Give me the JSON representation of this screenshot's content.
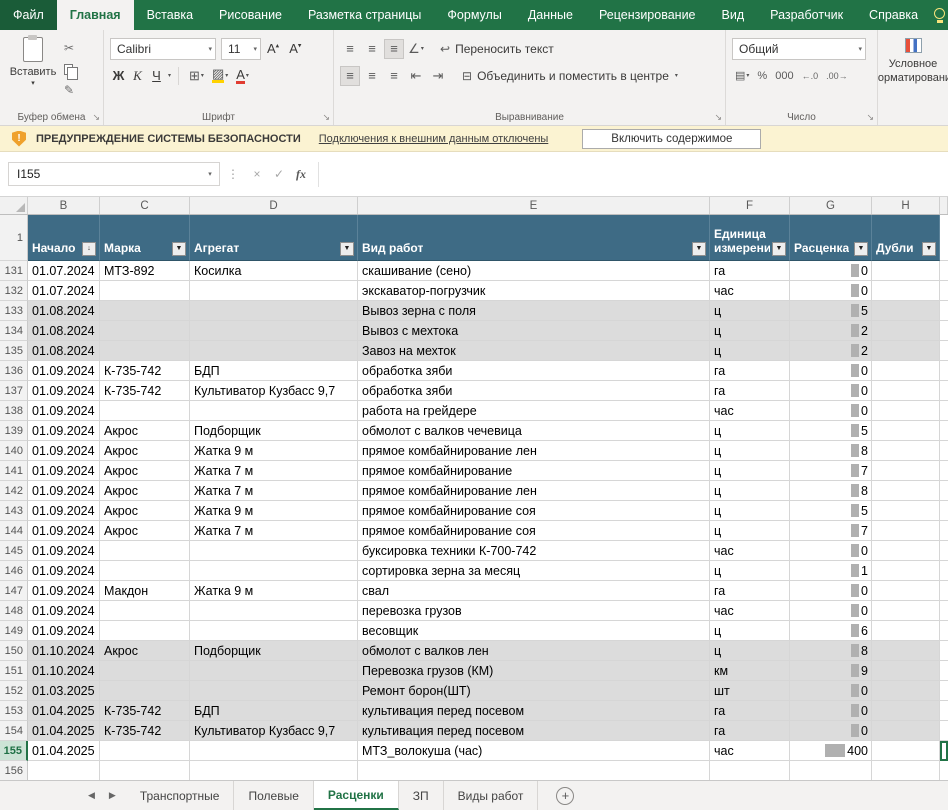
{
  "ribbon": {
    "tabs": [
      {
        "label": "Файл",
        "file": true
      },
      {
        "label": "Главная",
        "active": true
      },
      {
        "label": "Вставка"
      },
      {
        "label": "Рисование"
      },
      {
        "label": "Разметка страницы"
      },
      {
        "label": "Формулы"
      },
      {
        "label": "Данные"
      },
      {
        "label": "Рецензирование"
      },
      {
        "label": "Вид"
      },
      {
        "label": "Разработчик"
      },
      {
        "label": "Справка"
      }
    ],
    "clipboard": {
      "group_label": "Буфер обмена",
      "paste_label": "Вставить"
    },
    "font": {
      "group_label": "Шрифт",
      "font_name": "Calibri",
      "font_size": "11",
      "bold": "Ж",
      "italic": "К",
      "underline": "Ч"
    },
    "alignment": {
      "group_label": "Выравнивание",
      "wrap_text": "Переносить текст",
      "merge_center": "Объединить и поместить в центре"
    },
    "number": {
      "group_label": "Число",
      "format": "Общий",
      "percent_icon": "%",
      "thousands_icon": "000",
      "inc_decimal_icon": "←.0",
      "dec_decimal_icon": ".00→"
    },
    "conditional": {
      "line1": "Условное",
      "line2": "форматирование"
    }
  },
  "security": {
    "title": "ПРЕДУПРЕЖДЕНИЕ СИСТЕМЫ БЕЗОПАСНОСТИ",
    "message": "Подключения к внешним данным отключены",
    "button": "Включить содержимое"
  },
  "formula_bar": {
    "name_box": "I155",
    "formula": ""
  },
  "sheet": {
    "columns": [
      "B",
      "C",
      "D",
      "E",
      "F",
      "G",
      "H"
    ],
    "headers": [
      {
        "label": "Начало",
        "sorted": true
      },
      {
        "label": "Марка"
      },
      {
        "label": "Агрегат"
      },
      {
        "label": "Вид работ"
      },
      {
        "label": "Единица измерени"
      },
      {
        "label": "Расценка"
      },
      {
        "label": "Дубли"
      }
    ],
    "bar_max": 400,
    "rows": [
      {
        "n": 131,
        "b": "01.07.2024",
        "c": "МТЗ-892",
        "d": "Косилка",
        "e": "скашивание (сено)",
        "f": "га",
        "g": 0
      },
      {
        "n": 132,
        "b": "01.07.2024",
        "c": "",
        "d": "",
        "e": "экскаватор-погрузчик",
        "f": "час",
        "g": 0
      },
      {
        "n": 133,
        "b": "01.08.2024",
        "c": "",
        "d": "",
        "e": "Вывоз зерна с поля",
        "f": "ц",
        "g": 5,
        "shaded": true
      },
      {
        "n": 134,
        "b": "01.08.2024",
        "c": "",
        "d": "",
        "e": "Вывоз с мехтока",
        "f": "ц",
        "g": 2,
        "shaded": true
      },
      {
        "n": 135,
        "b": "01.08.2024",
        "c": "",
        "d": "",
        "e": "Завоз на мехток",
        "f": "ц",
        "g": 2,
        "shaded": true
      },
      {
        "n": 136,
        "b": "01.09.2024",
        "c": "К-735-742",
        "d": "БДП",
        "e": "обработка зяби",
        "f": "га",
        "g": 0
      },
      {
        "n": 137,
        "b": "01.09.2024",
        "c": "К-735-742",
        "d": "Культиватор Кузбасс 9,7",
        "e": "обработка зяби",
        "f": "га",
        "g": 0
      },
      {
        "n": 138,
        "b": "01.09.2024",
        "c": "",
        "d": "",
        "e": "работа на грейдере",
        "f": "час",
        "g": 0
      },
      {
        "n": 139,
        "b": "01.09.2024",
        "c": "Акрос",
        "d": "Подборщик",
        "e": "обмолот с валков чечевица",
        "f": "ц",
        "g": 5
      },
      {
        "n": 140,
        "b": "01.09.2024",
        "c": "Акрос",
        "d": "Жатка 9 м",
        "e": "прямое комбайнирование лен",
        "f": "ц",
        "g": 8
      },
      {
        "n": 141,
        "b": "01.09.2024",
        "c": "Акрос",
        "d": "Жатка 7 м",
        "e": "прямое комбайнирование",
        "f": "ц",
        "g": 7
      },
      {
        "n": 142,
        "b": "01.09.2024",
        "c": "Акрос",
        "d": "Жатка 7 м",
        "e": "прямое комбайнирование лен",
        "f": "ц",
        "g": 8
      },
      {
        "n": 143,
        "b": "01.09.2024",
        "c": "Акрос",
        "d": "Жатка 9 м",
        "e": "прямое комбайнирование соя",
        "f": "ц",
        "g": 5
      },
      {
        "n": 144,
        "b": "01.09.2024",
        "c": "Акрос",
        "d": "Жатка 7 м",
        "e": "прямое комбайнирование соя",
        "f": "ц",
        "g": 7
      },
      {
        "n": 145,
        "b": "01.09.2024",
        "c": "",
        "d": "",
        "e": "буксировка техники К-700-742",
        "f": "час",
        "g": 0
      },
      {
        "n": 146,
        "b": "01.09.2024",
        "c": "",
        "d": "",
        "e": "сортировка зерна за месяц",
        "f": "ц",
        "g": 1
      },
      {
        "n": 147,
        "b": "01.09.2024",
        "c": "Макдон",
        "d": "Жатка 9 м",
        "e": "свал",
        "f": "га",
        "g": 0
      },
      {
        "n": 148,
        "b": "01.09.2024",
        "c": "",
        "d": "",
        "e": "перевозка грузов",
        "f": "час",
        "g": 0
      },
      {
        "n": 149,
        "b": "01.09.2024",
        "c": "",
        "d": "",
        "e": "весовщик",
        "f": "ц",
        "g": 6
      },
      {
        "n": 150,
        "b": "01.10.2024",
        "c": "Акрос",
        "d": "Подборщик",
        "e": "обмолот с валков лен",
        "f": "ц",
        "g": 8,
        "shaded": true
      },
      {
        "n": 151,
        "b": "01.10.2024",
        "c": "",
        "d": "",
        "e": "Перевозка грузов (КМ)",
        "f": "км",
        "g": 9,
        "shaded": true
      },
      {
        "n": 152,
        "b": "01.03.2025",
        "c": "",
        "d": "",
        "e": "Ремонт борон(ШТ)",
        "f": "шт",
        "g": 0,
        "shaded": true
      },
      {
        "n": 153,
        "b": "01.04.2025",
        "c": "К-735-742",
        "d": "БДП",
        "e": "культивация перед посевом",
        "f": "га",
        "g": 0,
        "shaded": true
      },
      {
        "n": 154,
        "b": "01.04.2025",
        "c": "К-735-742",
        "d": "Культиватор Кузбасс 9,7",
        "e": "культивация перед посевом",
        "f": "га",
        "g": 0,
        "shaded": true
      },
      {
        "n": 155,
        "b": "01.04.2025",
        "c": "",
        "d": "",
        "e": "МТЗ_волокуша (час)",
        "f": "час",
        "g": 400,
        "selected": true
      },
      {
        "n": 156,
        "b": "",
        "c": "",
        "d": "",
        "e": "",
        "f": "",
        "g": null
      }
    ]
  },
  "sheet_tabs": {
    "items": [
      {
        "label": "Транспортные"
      },
      {
        "label": "Полевые"
      },
      {
        "label": "Расценки",
        "active": true
      },
      {
        "label": "ЗП"
      },
      {
        "label": "Виды работ"
      }
    ],
    "add_label": "+"
  },
  "colors": {
    "excel_green": "#217346",
    "table_header": "#3E6B85",
    "banded_row": "#DCDCDC",
    "warning_bg": "#FBF3D2"
  }
}
